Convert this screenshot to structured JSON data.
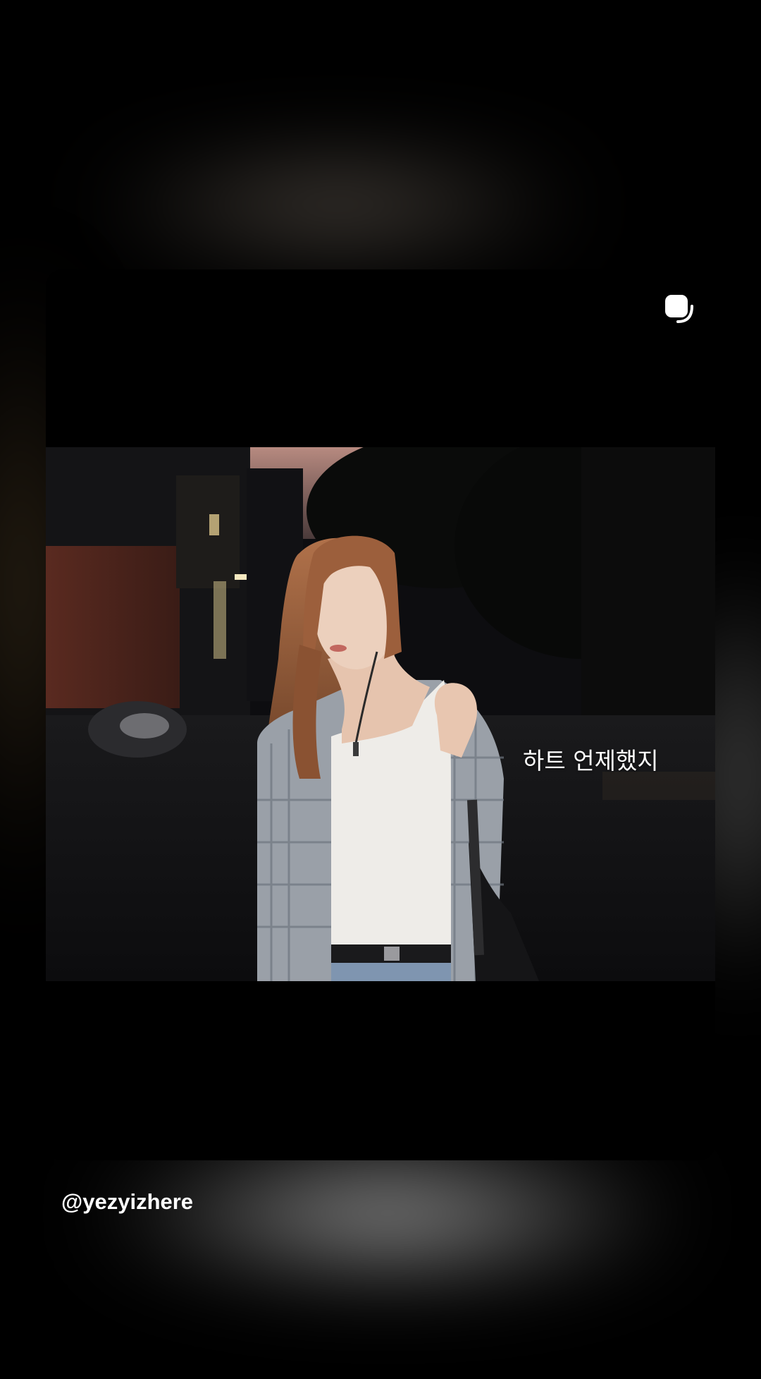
{
  "story": {
    "overlay_text": "하트 언제했지",
    "mention": "@yezyizhere",
    "icon": "reshare-stack-icon"
  },
  "colors": {
    "background": "#000000",
    "text": "#ffffff"
  }
}
